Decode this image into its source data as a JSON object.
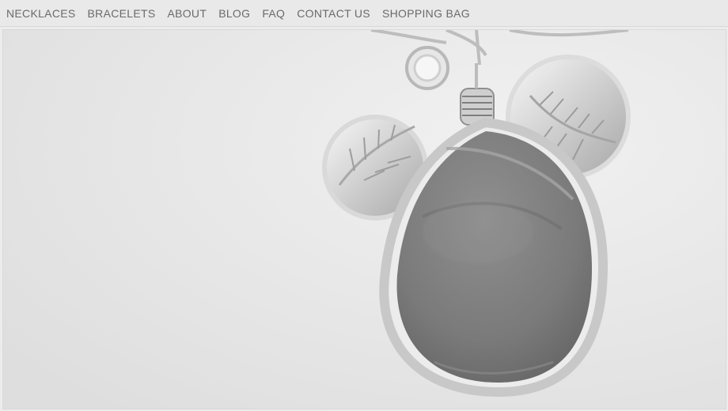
{
  "nav": {
    "items": [
      {
        "label": "NECKLACES"
      },
      {
        "label": "BRACELETS"
      },
      {
        "label": "ABOUT"
      },
      {
        "label": "BLOG"
      },
      {
        "label": "FAQ"
      },
      {
        "label": "CONTACT US"
      },
      {
        "label": "SHOPPING BAG"
      }
    ]
  },
  "hero": {
    "subject": "pendant-necklace-photo",
    "colors": {
      "background": "#e6e6e6",
      "silver": "#cfcfcf",
      "stone": "#7d7d7d"
    }
  }
}
